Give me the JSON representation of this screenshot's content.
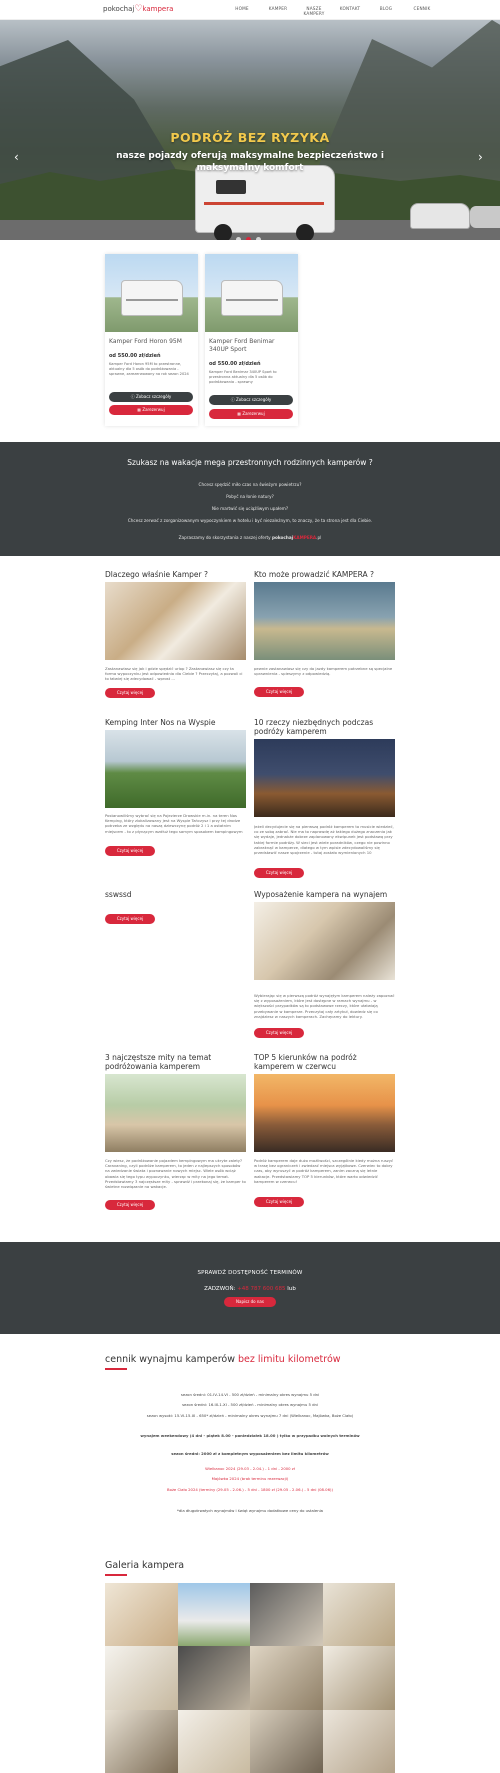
{
  "header": {
    "logo_text_1": "pokochaj",
    "logo_text_2": "kampera",
    "nav": [
      "HOME",
      "KAMPER",
      "NASZE KAMPERY",
      "KONTAKT",
      "BLOG",
      "CENNIK"
    ]
  },
  "hero": {
    "title": "PODRÓŻ BEZ RYZYKA",
    "subtitle": "nasze pojazdy oferują maksymalne bezpieczeństwo i maksymalny komfort",
    "prev_icon": "chevron-left-icon",
    "next_icon": "chevron-right-icon",
    "slides": 3,
    "active_slide": 2
  },
  "products": [
    {
      "name": "Kamper Ford Horon 95M",
      "price": "od 550.00 zł/dzień",
      "desc": "Kamper Ford Horon 95M to przestronne, aktualny dla 5 osób do podróżowania - sprawne, zarezerwowany na rok sezon 2024",
      "details_label": "Zobacz szczegóły",
      "book_label": "Zarezerwuj"
    },
    {
      "name": "Kamper Ford Benimar 340UP Sport",
      "price": "od 550.00 zł/dzień",
      "desc": "Kamper Ford Benimar 340UP Sport to przestronna aktualny dla 5 osób do podróżowania - sprawny",
      "details_label": "Zobacz szczegóły",
      "book_label": "Zarezerwuj"
    }
  ],
  "band": {
    "heading": "Szukasz na wakacje mega przestronnych rodzinnych kamperów ?",
    "lines": [
      "Chcesz spędzić miło czas na świeżym powietrzu?",
      "Pobyć na łonie natury?",
      "Nie martwić się uciążliwym upałem?",
      "Chcesz zerwać z zorganizowanym wypoczynkiem w hotelu i być niezależnym, to znaczy, że ta strona jest dla Ciebie."
    ],
    "invite_prefix": "Zapraszamy do skorzystania z naszej oferty ",
    "invite_brand_1": "pokochaj",
    "invite_brand_2": "KAMPERA",
    "invite_suffix": ".pl"
  },
  "posts": [
    {
      "title": "Dlaczego właśnie Kamper ?",
      "text": "Zastanawiasz się jak i gdzie spędzić urlop ? Zastanawiasz się czy ta forma wypoczynku jest odpowiednia dla Ciebie ? Przeczytaj, a pozwoli ci to łatwiej się zdecydować - wprost ...",
      "button": "Czytaj więcej"
    },
    {
      "title": "Kto może prowadzić KAMPERA ?",
      "text": "pewnie zastanawiasz się czy do jazdy kamperem potrzebne są specjalne uprawnienia - spieszymy z odpowiedzią.",
      "button": "Czytaj więcej"
    },
    {
      "title": "Kemping Inter Nos na Wyspie",
      "text": "Postanowiliśmy wybrać się na Pojezierze Drawskie m.in. na teren Nos Kemping, który zlokalizowany jest na Wyspie Tańczysz i przy tej drodze potrzeba ze względu na naszą dziewczynę podróż 2 i 1 a ostatnim miejscem - to z płynącym wzdłuż tego samym sposobem kampingowym zjazd z Anchor. Niestety trzeba się pewnego noclegu w tej samej.",
      "button": "Czytaj więcej"
    },
    {
      "title": "10 rzeczy niezbędnych podczas podróży kamperem",
      "text": "Jeżeli decydujecie się na pierwszą podróż kamperem to musicie wiedzieć, co ze sobą zabrać. Nie ma to naprawdę aż takiego dużego znaczenia jak się wydaje, jednakże dobrze zaplanowany ekwipunek jest podstawą przy takiej formie podróży. W sieci jest wiele poradników, czego nie powinno zabraknąć w kamperze, dlatego w tym wpisie zdecydowaliśmy się przedstawić nasze spojrzenie - tutaj zostało wymienionych 10 niezbędnych rzeczy podczas kempingu z kamperem.",
      "button": "Czytaj więcej"
    },
    {
      "title": "sswssd",
      "text": "",
      "button": "Czytaj więcej"
    },
    {
      "title": "Wyposażenie kampera na wynajem",
      "text": "Wybierając się w pierwszą podróż wynajętym kamperem należy zapoznać się z wyposażeniem, które jest dostępne w ramach wynajmu - w większości przypadków są to podstawowe rzeczy, które ułatwiają przebywanie w kamperze. Przeczytaj cały artykuł, dowiedz się co znajdziesz w naszych kamperach. Zachęcamy do lektury.",
      "button": "Czytaj więcej"
    },
    {
      "title": "3 najczęstsze mity na temat podróżowania kamperem",
      "text": "Czy wiesz, że podróżowanie pojazdem kempingowym ma ukryte zalety? Caravaning, czyli podróże kamperem, to jeden z najlepszych sposobów na zwiedzanie świata i poznawanie nowych miejsc. Wiele osób wciąż obawia się tego typu wypoczynku, wierząc w mity na jego temat. Przedstawiamy 3 najczęstsze mity - sprawdź i przekonaj się, że kamper to świetne rozwiązanie na wakacje.",
      "button": "Czytaj więcej"
    },
    {
      "title": "TOP 5 kierunków na podróż kamperem w czerwcu",
      "text": "Podróż kamperem daje dużo możliwości, szczególnie kiedy można ruszyć w trasę bez ograniczeń i zwiedzać miejsca wyjątkowe. Czerwiec to dobry czas, aby wyruszyć w podróż kamperem, zanim zaczną się letnie wakacje. Przedstawiamy TOP 5 kierunków, które warto odwiedzić kamperem w czerwcu!",
      "button": "Czytaj więcej"
    }
  ],
  "availability": {
    "title": "SPRAWDŹ DOSTĘPNOŚĆ TERMINÓW",
    "phone_prefix": "ZADZWOŃ: ",
    "phone": "+48 787 600 685",
    "phone_suffix": " lub",
    "button": "Napisz do nas"
  },
  "pricing": {
    "heading_1": "cennik wynajmu kamperów ",
    "heading_2": "bez limitu kilometrów",
    "lines": [
      {
        "text": "sezon średni: 01.IV-14.VI - 500 zł/dzień - minimalny okres wynajmu 5 dni",
        "style": "normal"
      },
      {
        "text": "sezon średni: 16.IX-1.XI - 500 zł/dzień - minimalny okres wynajmu 5 dni",
        "style": "normal"
      },
      {
        "text": "sezon wysoki: 15.VI-15.IX - 650* zł/dzień - minimalny okres wynajmu 7 dni (Wielkanoc, Majówka, Boże Ciało)",
        "style": "normal"
      },
      {
        "text": "wynajem weekendowy (4 dni - piątek 8.00 - poniedziałek 18.00 ) tylko w przypadku wolnych terminów",
        "style": "bold"
      },
      {
        "text": "sezon średni: 2000 zł z kompletnym wyposażeniem bez limitu kilometrów",
        "style": "bold"
      },
      {
        "text": "Wielkanoc 2024 (29.03 - 2.04.) - 1 dni - 2000 zł",
        "style": "red"
      },
      {
        "text": "Majówka 2024 (brak terminu rezerwacji)",
        "style": "red"
      },
      {
        "text": "Boże Ciało 2024 (terminy (29.05 - 2.06.) - 5 dni - 1800 zł (29.05 - 2.06.) - 5 dni (08.06))",
        "style": "red"
      },
      {
        "text": "*dla długotrwałych wynajmów i świąt wynajmu dodatkowe ceny do ustalenia",
        "style": "normal"
      }
    ]
  },
  "gallery": {
    "heading": "Galeria kampera"
  }
}
